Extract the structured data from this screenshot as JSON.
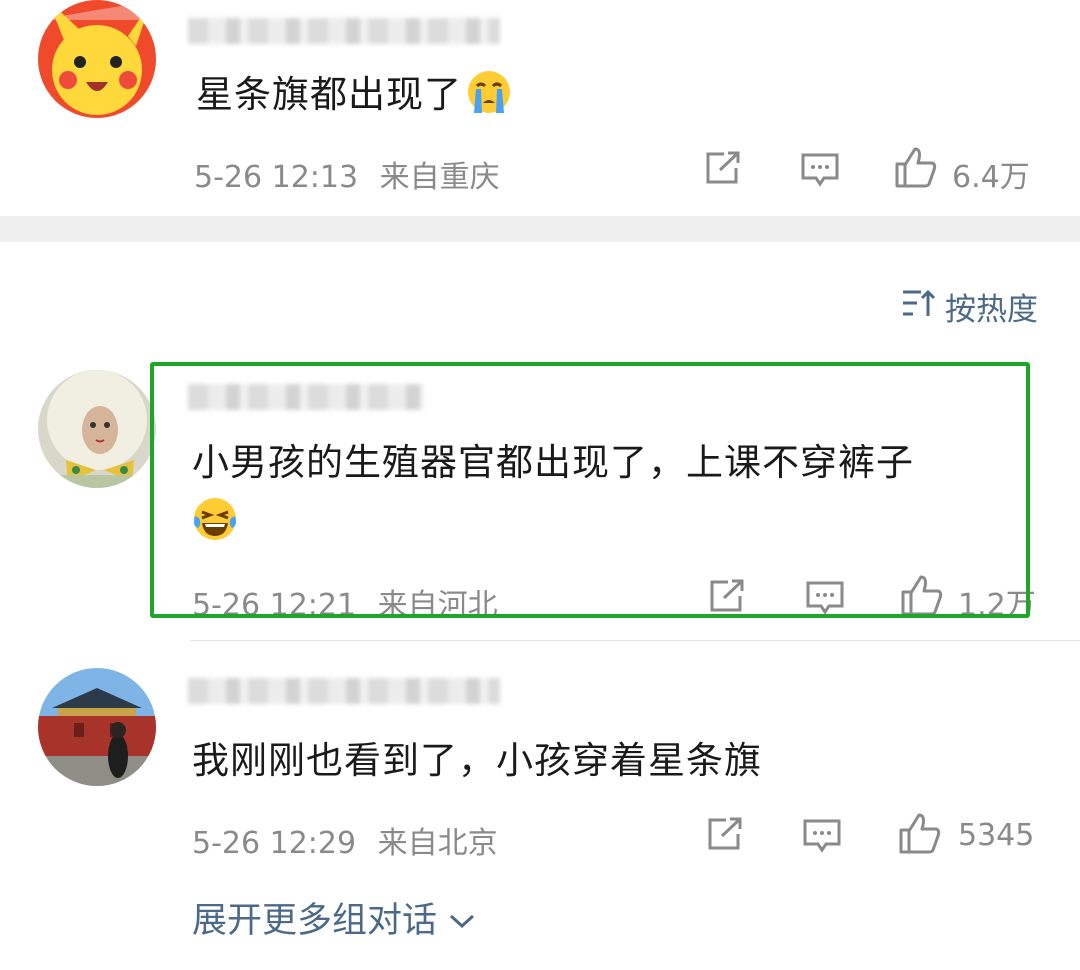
{
  "comments": [
    {
      "avatar": "pikachu-avatar",
      "text": "星条旗都出现了",
      "emoji": "crying-face-emoji",
      "timestamp": "5-26 12:13",
      "location": "来自重庆",
      "likes": "6.4万"
    },
    {
      "avatar": "doll-avatar",
      "text": "小男孩的生殖器官都出现了，上课不穿裤子",
      "emoji": "laughing-tears-emoji",
      "timestamp": "5-26 12:21",
      "location": "来自河北",
      "likes": "1.2万"
    },
    {
      "avatar": "palace-avatar",
      "text": "我刚刚也看到了，小孩穿着星条旗",
      "timestamp": "5-26 12:29",
      "location": "来自北京",
      "likes": "5345"
    }
  ],
  "sort": {
    "label": "按热度",
    "icon": "sort-icon"
  },
  "expand_label": "展开更多组对话",
  "colors": {
    "highlight": "#1fa628",
    "link": "#4b6a88",
    "meta": "#8a8a8a"
  }
}
